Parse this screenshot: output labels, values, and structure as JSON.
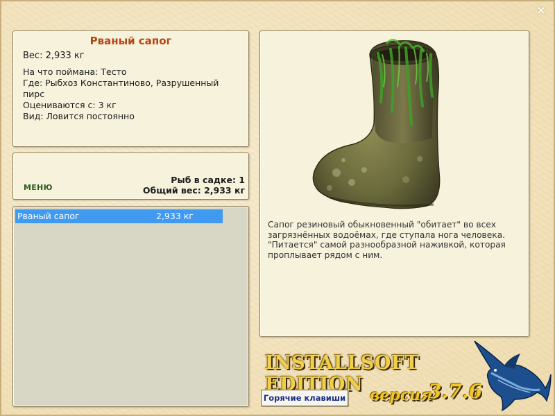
{
  "window": {
    "close_label": "×"
  },
  "fish_info": {
    "name": "Рваный сапог",
    "weight": "Вес: 2,933 кг",
    "caught_on": "На что поймана: Тесто",
    "where": "Где: Рыбхоз Константиново, Разрушенный пирс",
    "valued_from": "Оцениваются с: 3 кг",
    "kind": "Вид: Ловится постоянно"
  },
  "menu": {
    "menu_label": "МЕНЮ",
    "fish_in_cage": "Рыб в садке: 1",
    "total_weight": "Общий вес: 2,933 кг"
  },
  "catch_list": [
    {
      "name": "Рваный сапог",
      "weight": "2,933 кг"
    }
  ],
  "description": {
    "image_icon": "rubber-boot-image",
    "text": "Сапог резиновый обыкновенный \"обитает\" во всех загрязнённых водоёмах, где ступала нога человека. \"Питается\" самой разнообразной наживкой, которая проплывает рядом с ним."
  },
  "branding": {
    "edition": "INSTALLSOFT EDITION",
    "version_label": "версия",
    "version_number": "3.7.6",
    "hotkeys_label": "Горячие клавиши",
    "logo_icon": "marlin-fish-icon"
  }
}
